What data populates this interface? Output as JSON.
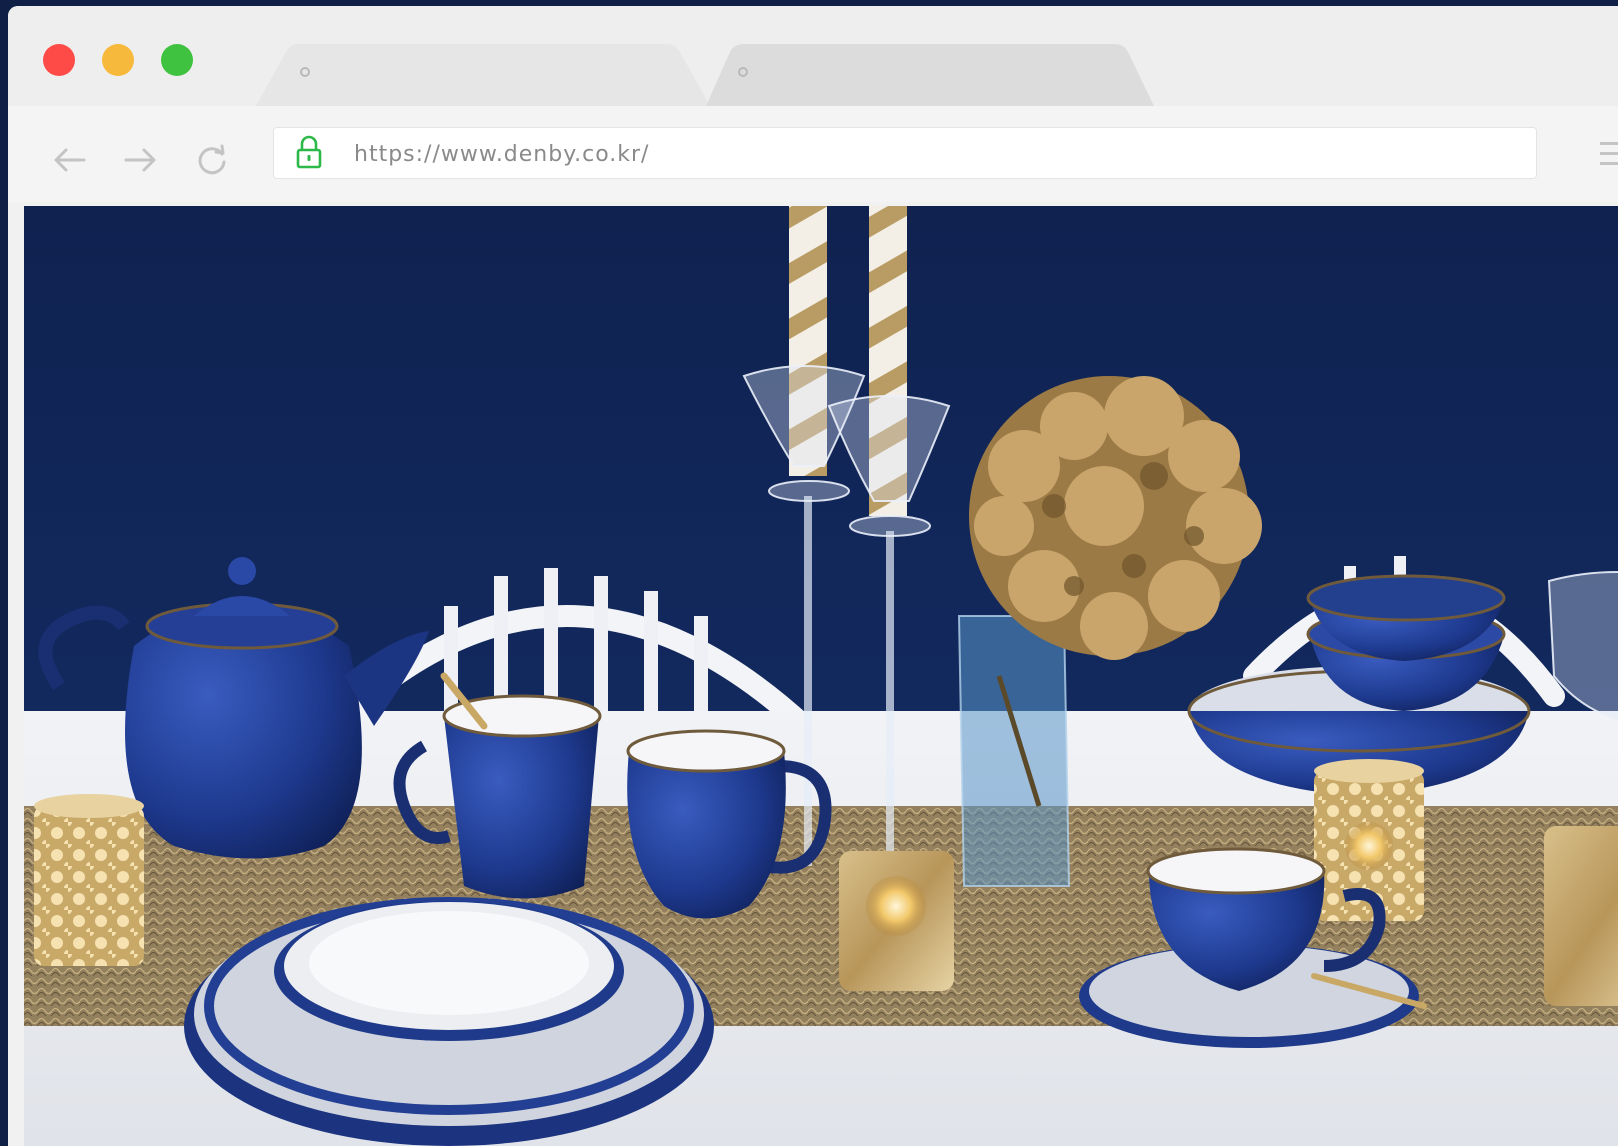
{
  "browser": {
    "url": "https://www.denby.co.kr/",
    "tabs": [
      {
        "label": ""
      },
      {
        "label": ""
      }
    ],
    "colors": {
      "close": "#ff4b48",
      "minimize": "#f6b93b",
      "maximize": "#3fc23f",
      "lock": "#2db84a"
    },
    "icons": {
      "back": "arrow-left-icon",
      "forward": "arrow-right-icon",
      "reload": "reload-icon",
      "secure": "lock-icon",
      "menu": "hamburger-menu-icon"
    }
  },
  "page": {
    "hero_image": "photo of navy-blue tableware set with candles and dried hydrangea"
  }
}
